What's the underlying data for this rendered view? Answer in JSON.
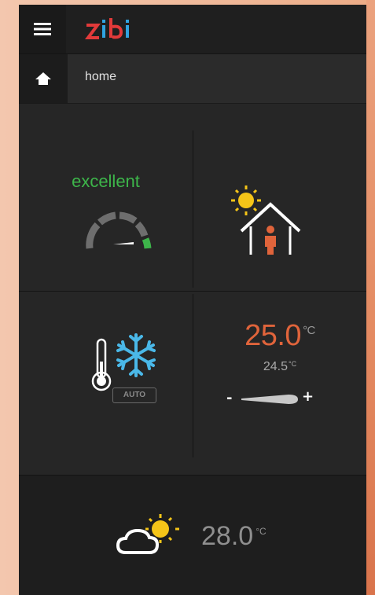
{
  "app": {
    "logo_text": "zibi"
  },
  "breadcrumb": {
    "label": "home"
  },
  "air_quality": {
    "label": "excellent",
    "gauge_level": 0.85,
    "color": "#3db54a"
  },
  "mode": {
    "badge": "AUTO",
    "mode_icon": "snowflake-icon",
    "sensor_icon": "thermometer-icon"
  },
  "climate": {
    "setpoint": "25.0",
    "setpoint_unit": "°C",
    "current": "24.5",
    "current_unit": "°C",
    "decrease_label": "-",
    "increase_label": "+",
    "setpoint_color": "#e0643b"
  },
  "weather": {
    "temperature": "28.0",
    "unit": "°C",
    "icon": "partly-sunny-icon"
  },
  "colors": {
    "accent_green": "#3db54a",
    "accent_orange": "#e0643b",
    "snow_blue": "#4ab8e8",
    "sun_yellow": "#f5c518"
  }
}
